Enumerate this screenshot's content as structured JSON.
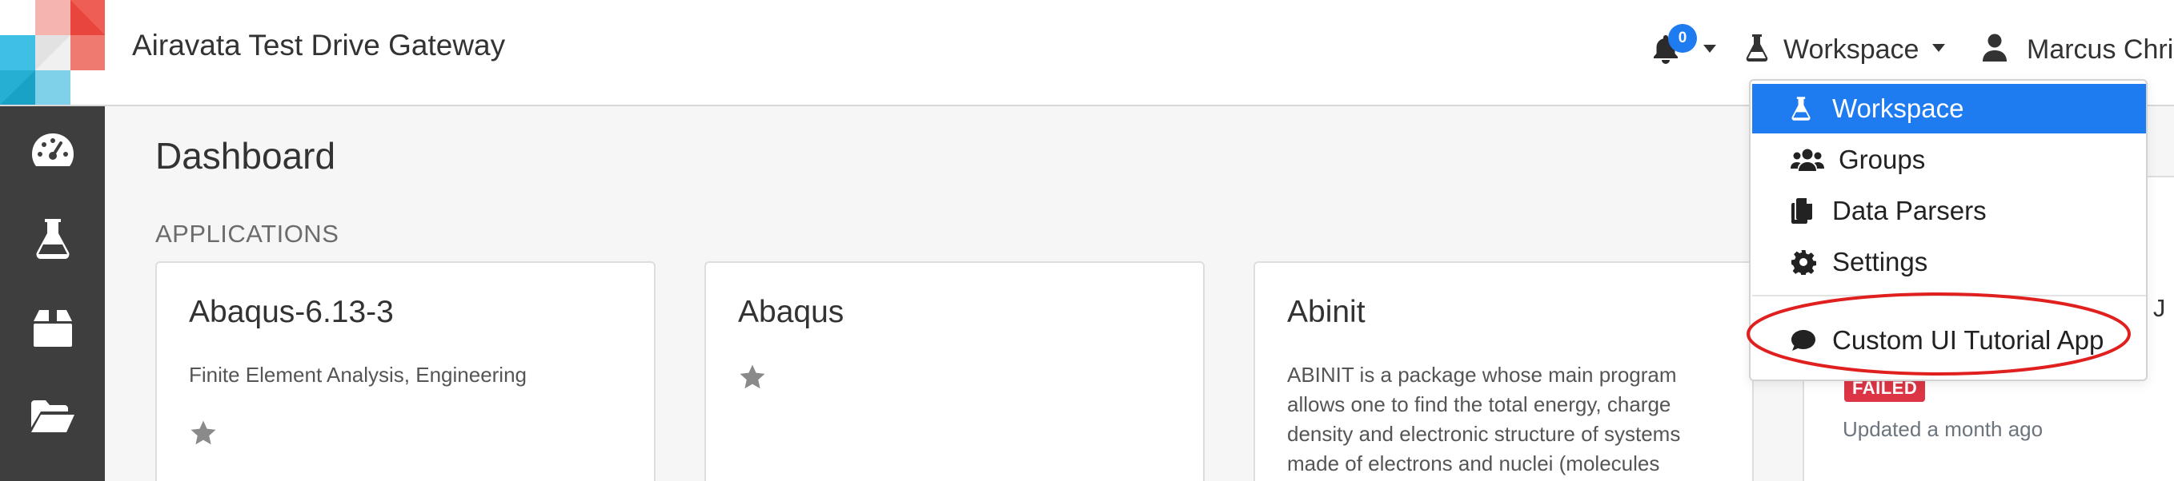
{
  "header": {
    "title": "Airavata Test Drive Gateway",
    "notification_count": "0",
    "workspace_label": "Workspace",
    "user_label": "Marcus Chri"
  },
  "sidebar": {
    "items": [
      {
        "icon": "dashboard-icon"
      },
      {
        "icon": "flask-icon"
      },
      {
        "icon": "box-icon"
      },
      {
        "icon": "folder-open-icon"
      }
    ]
  },
  "main": {
    "page_title": "Dashboard",
    "section_label": "APPLICATIONS",
    "cards": [
      {
        "name": "Abaqus-6.13-3",
        "description": "Finite Element Analysis, Engineering"
      },
      {
        "name": "Abaqus",
        "description": ""
      },
      {
        "name": "Abinit",
        "description": "ABINIT is a package whose main program allows one to find the total energy, charge density and electronic structure of systems made of electrons and nuclei (molecules"
      }
    ]
  },
  "right_panel": {
    "peek_text": "n J",
    "status": "FAILED",
    "updated": "Updated a month ago"
  },
  "dropdown": {
    "items": [
      {
        "label": "Workspace",
        "icon": "flask-icon",
        "active": true
      },
      {
        "label": "Groups",
        "icon": "users-icon",
        "active": false
      },
      {
        "label": "Data Parsers",
        "icon": "copy-icon",
        "active": false
      },
      {
        "label": "Settings",
        "icon": "gear-icon",
        "active": false
      },
      {
        "label": "Custom UI Tutorial App",
        "icon": "comment-icon",
        "active": false
      }
    ]
  },
  "colors": {
    "accent": "#1e7bf0",
    "sidebar": "#3e3e3e",
    "failed": "#dc3545",
    "highlight_ring": "#e0201f"
  }
}
